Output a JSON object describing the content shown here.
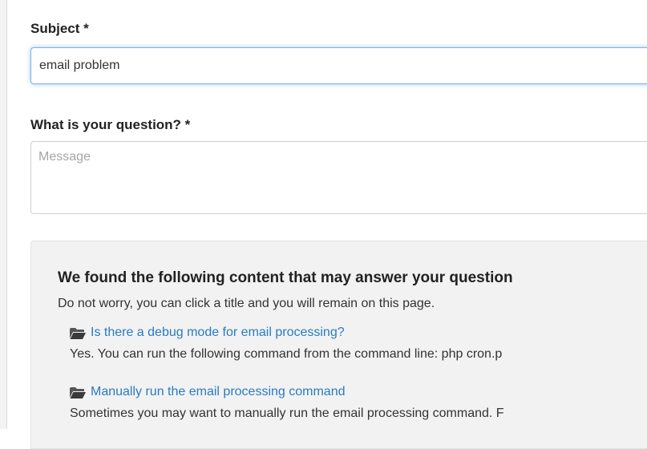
{
  "form": {
    "subject_label": "Subject *",
    "subject_value": "email problem",
    "question_label": "What is your question? *",
    "question_placeholder": "Message"
  },
  "suggestions": {
    "title": "We found the following content that may answer your question",
    "subtitle": "Do not worry, you can click a title and you will remain on this page.",
    "items": [
      {
        "icon": "folder-icon",
        "title": "Is there a debug mode for email processing?",
        "snippet": "Yes. You can run the following command from the command line: php cron.p"
      },
      {
        "icon": "folder-icon",
        "title": "Manually run the email processing command",
        "snippet": "Sometimes you may want to manually run the email processing command. F"
      }
    ]
  },
  "colors": {
    "link": "#2a7bc0",
    "focus_border": "#7db0e8",
    "panel_bg": "#f2f2f2"
  }
}
